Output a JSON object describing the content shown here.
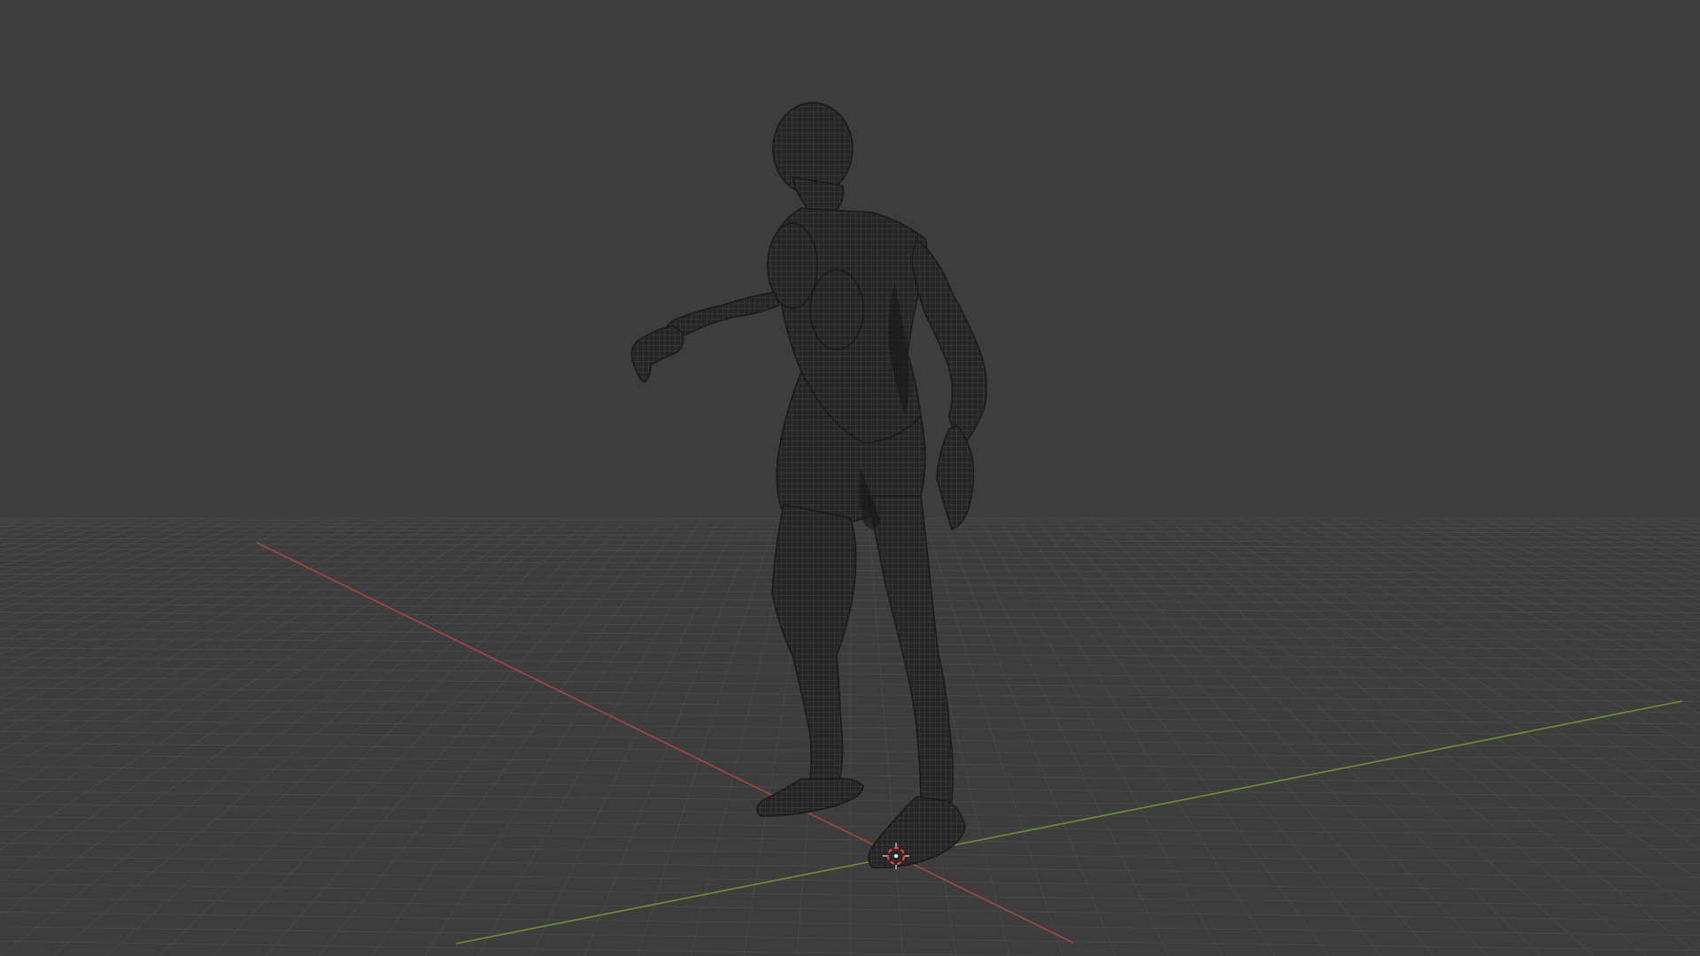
{
  "viewport": {
    "background_color": "#3d3d3d",
    "grid_line_color": "#4b4b4b",
    "x_axis_color": "#a64646",
    "y_axis_color": "#6f8f3a",
    "mesh_fill_color": "#262626",
    "mesh_wire_color": "#4a4a4a",
    "mesh_shadow_color": "#1a1a1a",
    "cursor_color": "#ff4040",
    "cursor_inner_color": "#ffffff"
  },
  "scene": {
    "object_icon": "human-mesh-icon",
    "cursor_icon": "3d-cursor-icon"
  }
}
